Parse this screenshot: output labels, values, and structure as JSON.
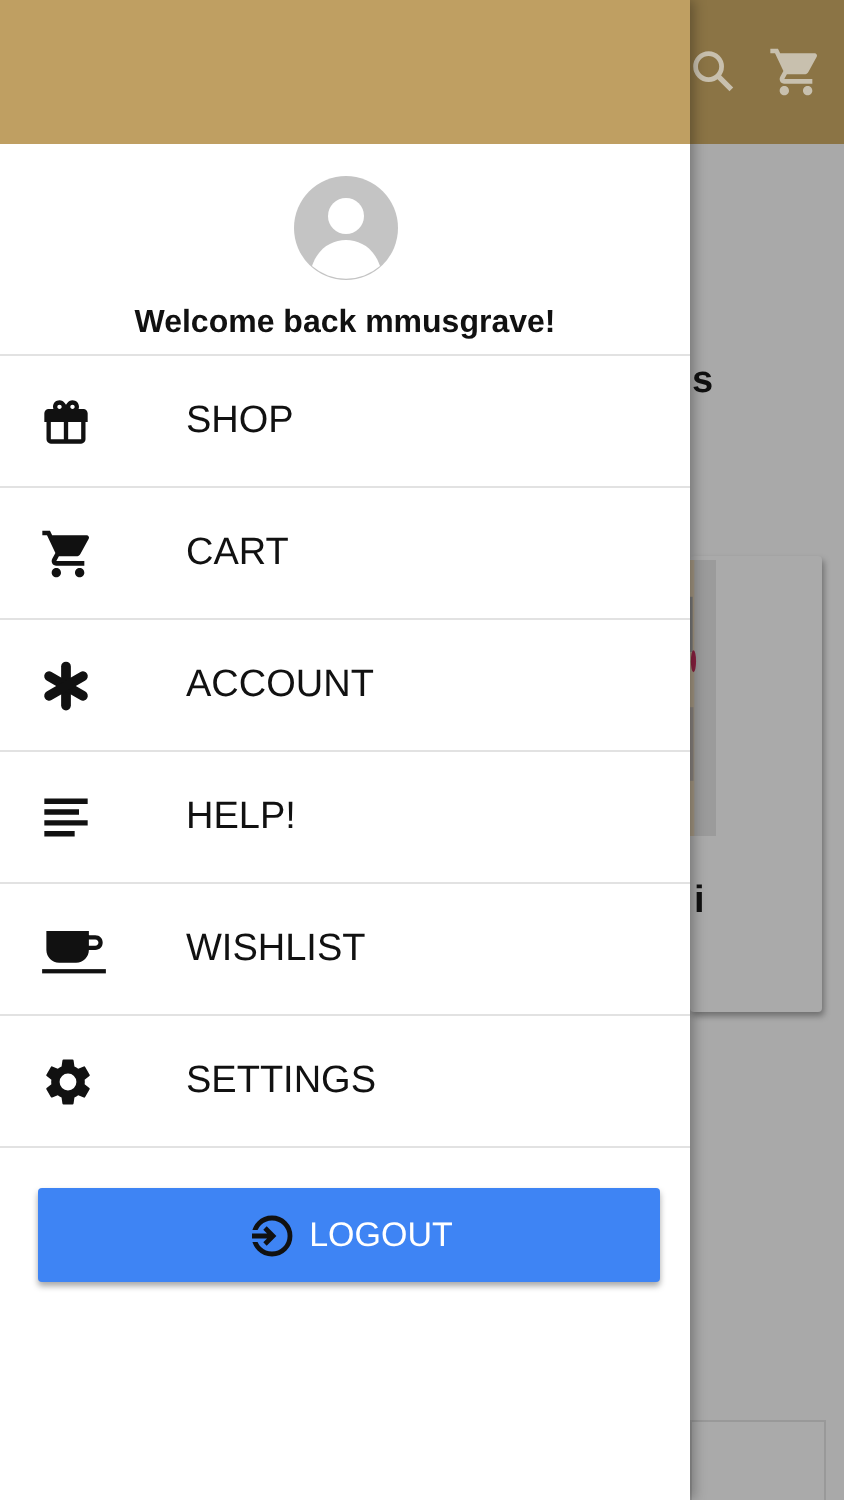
{
  "background_page": {
    "heading_fragment": "s",
    "card_title_fragment": "i"
  },
  "drawer": {
    "welcome": "Welcome back mmusgrave!",
    "items": [
      {
        "label": "SHOP",
        "kind": "gift"
      },
      {
        "label": "CART",
        "kind": "cart"
      },
      {
        "label": "ACCOUNT",
        "kind": "asterisk"
      },
      {
        "label": "HELP!",
        "kind": "lines"
      },
      {
        "label": "WISHLIST",
        "kind": "cup"
      },
      {
        "label": "SETTINGS",
        "kind": "gear"
      }
    ],
    "logout_button": "LOGOUT"
  }
}
